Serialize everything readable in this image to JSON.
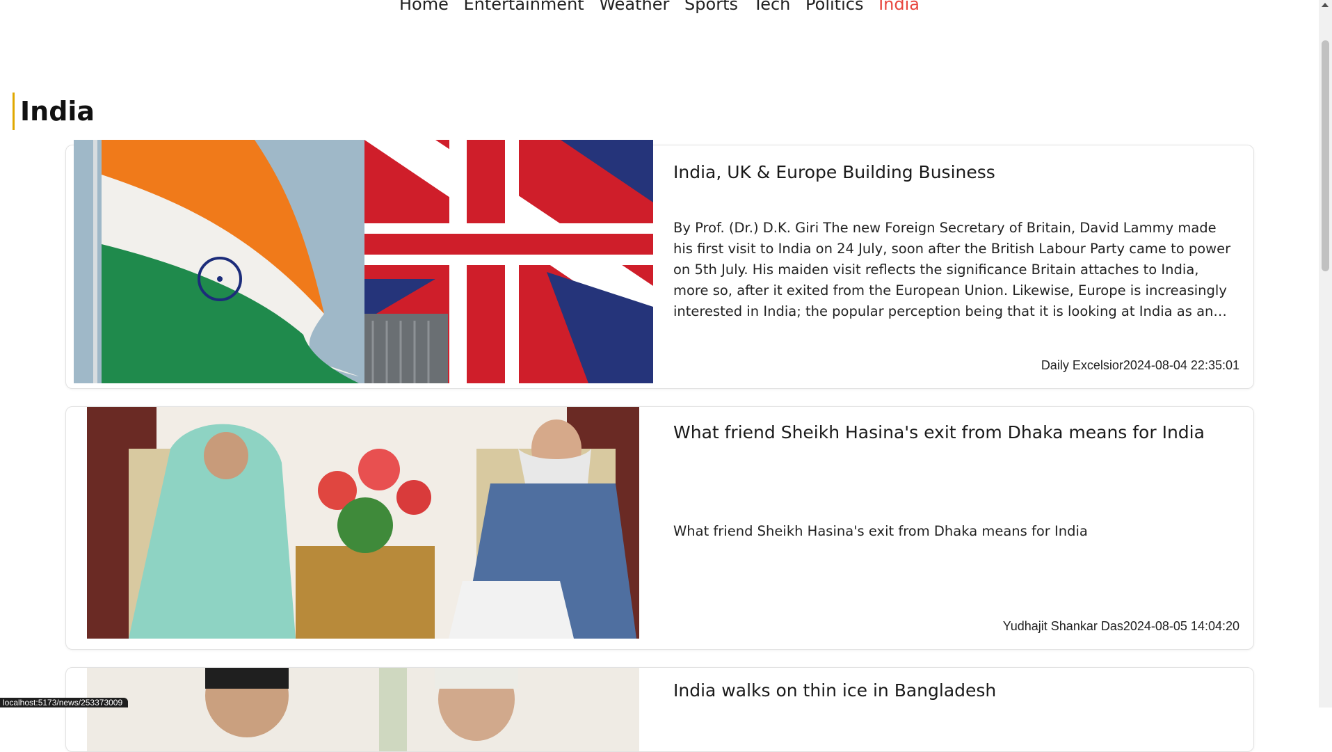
{
  "accent_color": "#e8473f",
  "heading_bar_color": "#e0a800",
  "nav": {
    "items": [
      {
        "label": "Home",
        "active": false
      },
      {
        "label": "Entertainment",
        "active": false
      },
      {
        "label": "Weather",
        "active": false
      },
      {
        "label": "Sports",
        "active": false
      },
      {
        "label": "Tech",
        "active": false
      },
      {
        "label": "Politics",
        "active": false
      },
      {
        "label": "India",
        "active": true
      }
    ]
  },
  "page": {
    "title": "India"
  },
  "articles": [
    {
      "title": "India, UK & Europe Building Business",
      "description": "By Prof. (Dr.) D.K. Giri The new Foreign Secretary of Britain, David Lammy made his first visit to India on 24 July, soon after the British Labour Party came to power on 5th July. His maiden visit reflects the significance Britain attaches to India, more so, after it exited from the European Union. Likewise, Europe is increasingly interested in India; the popular perception being that it is looking at India as an…",
      "source": "Daily Excelsior",
      "date": "2024-08-04 22:35:01",
      "image": "india-uk-flags"
    },
    {
      "title": "What friend Sheikh Hasina's exit from Dhaka means for India",
      "description": "What friend Sheikh Hasina's exit from Dhaka means for India",
      "source": "Yudhajit Shankar Das",
      "date": "2024-08-05 14:04:20",
      "image": "leaders-meeting"
    },
    {
      "title": "India walks on thin ice in Bangladesh",
      "image": "leaders-portrait"
    }
  ],
  "status_url": "localhost:5173/news/253373009"
}
